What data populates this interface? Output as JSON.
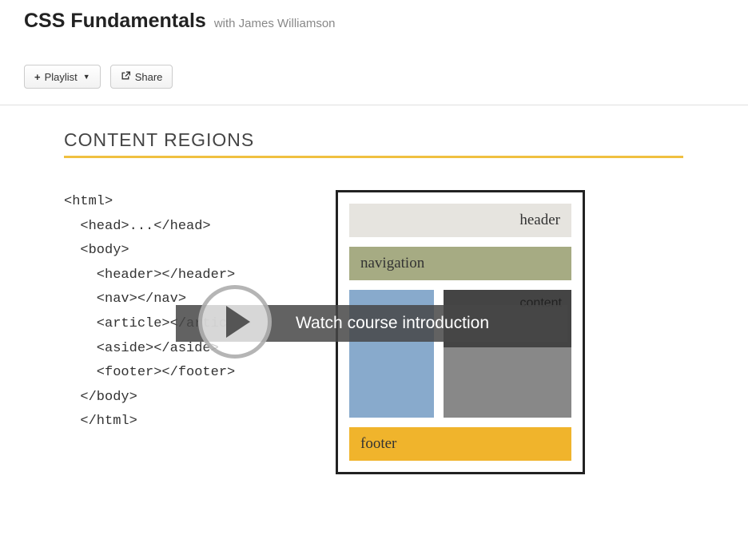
{
  "header": {
    "title": "CSS Fundamentals",
    "author": "with James Williamson"
  },
  "buttons": {
    "playlist": "Playlist",
    "share": "Share"
  },
  "slide": {
    "title": "CONTENT REGIONS",
    "code": "<html>\n  <head>...</head>\n  <body>\n    <header></header>\n    <nav></nav>\n    <article></article>\n    <aside></aside>\n    <footer></footer>\n  </body>\n  </html>",
    "regions": {
      "header": "header",
      "nav": "navigation",
      "content_label": "content",
      "footer": "footer"
    }
  },
  "overlay": {
    "text": "Watch course introduction"
  }
}
